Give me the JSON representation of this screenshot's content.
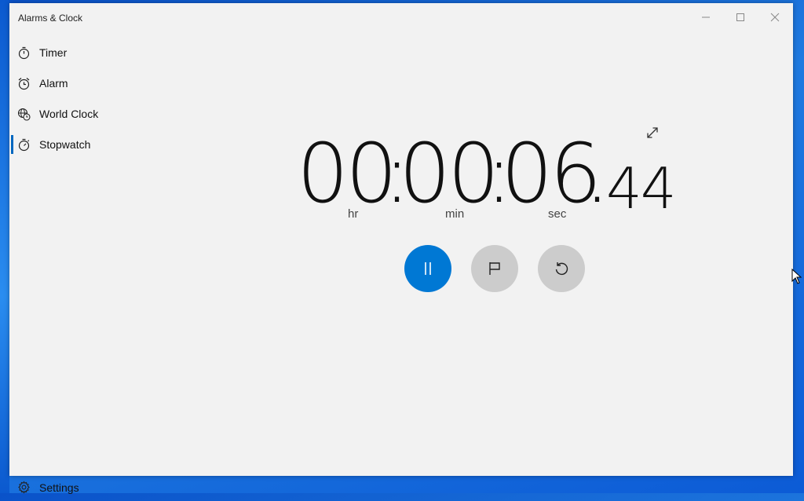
{
  "app": {
    "title": "Alarms & Clock",
    "accent": "#0078d4"
  },
  "window_controls": {
    "minimize_icon": "minimize-icon",
    "maximize_icon": "maximize-icon",
    "close_icon": "close-icon"
  },
  "sidebar": {
    "items": [
      {
        "label": "Timer",
        "icon": "timer-icon",
        "active": false
      },
      {
        "label": "Alarm",
        "icon": "alarm-clock-icon",
        "active": false
      },
      {
        "label": "World Clock",
        "icon": "globe-clock-icon",
        "active": false
      },
      {
        "label": "Stopwatch",
        "icon": "stopwatch-icon",
        "active": true
      }
    ],
    "settings_label": "Settings",
    "settings_icon": "gear-icon"
  },
  "stopwatch": {
    "hours": "00",
    "minutes": "00",
    "seconds": "06",
    "separator": ":",
    "decimal": ".",
    "hundredths": "44",
    "units": {
      "hr": "hr",
      "min": "min",
      "sec": "sec"
    },
    "buttons": {
      "pause_icon": "pause-icon",
      "lap_icon": "flag-icon",
      "reset_icon": "reset-icon",
      "expand_icon": "expand-icon"
    }
  }
}
